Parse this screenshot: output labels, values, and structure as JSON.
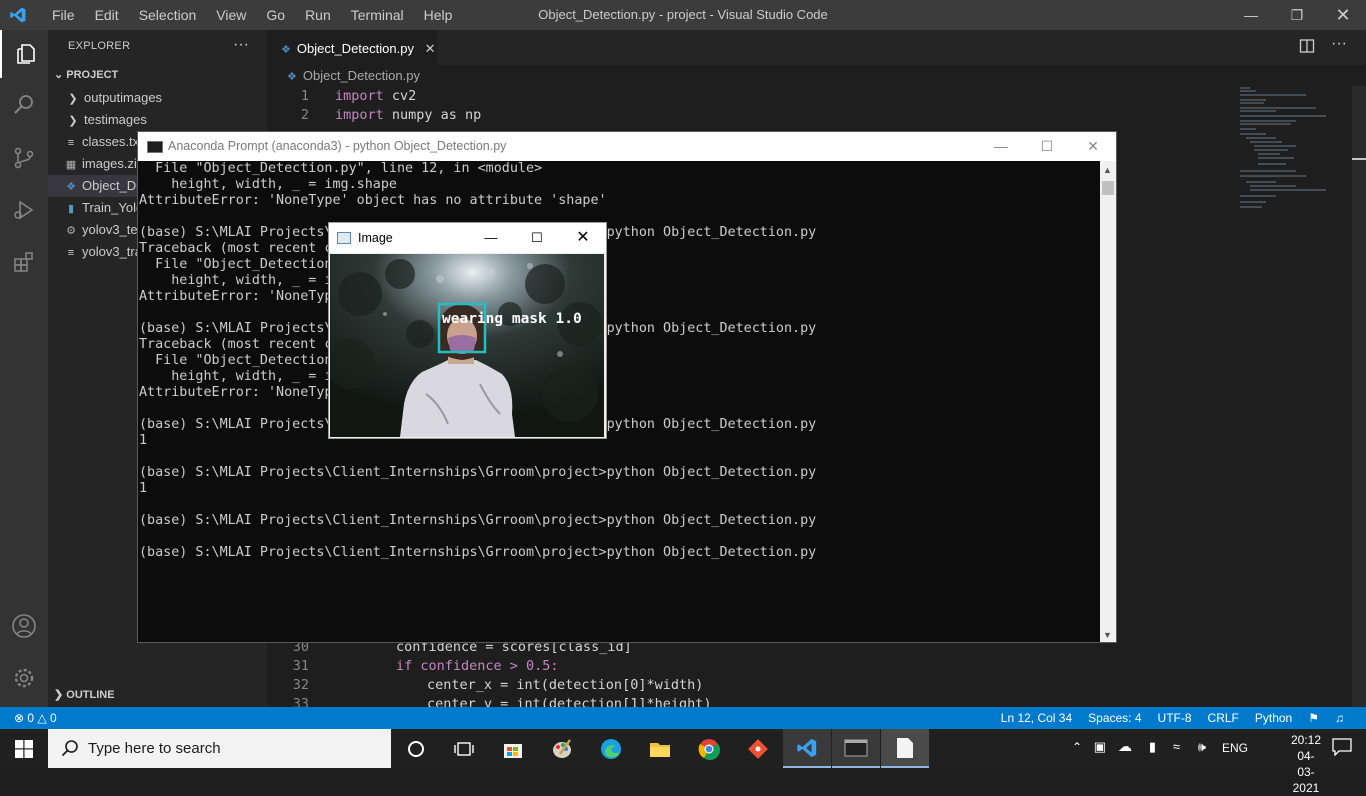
{
  "titlebar": {
    "menu": [
      "File",
      "Edit",
      "Selection",
      "View",
      "Go",
      "Run",
      "Terminal",
      "Help"
    ],
    "window_title": "Object_Detection.py - project - Visual Studio Code"
  },
  "sidebar": {
    "header": "EXPLORER",
    "project": "PROJECT",
    "items": [
      {
        "label": "outputimages",
        "kind": "folder"
      },
      {
        "label": "testimages",
        "kind": "folder"
      },
      {
        "label": "classes.txt",
        "kind": "file"
      },
      {
        "label": "images.zip",
        "kind": "file"
      },
      {
        "label": "Object_De",
        "kind": "python"
      },
      {
        "label": "Train_Yolo",
        "kind": "file"
      },
      {
        "label": "yolov3_te",
        "kind": "gear"
      },
      {
        "label": "yolov3_tra",
        "kind": "file"
      }
    ],
    "outline": "OUTLINE"
  },
  "editor": {
    "tab": "Object_Detection.py",
    "breadcrumb": "Object_Detection.py",
    "lines_top": [
      {
        "n": "1",
        "kw": "import",
        "rest": " cv2"
      },
      {
        "n": "2",
        "kw": "import",
        "rest": " numpy as np"
      }
    ],
    "lines_bottom": [
      {
        "n": "30",
        "text": "confidence = scores[class_id]"
      },
      {
        "n": "31",
        "text": "if confidence > 0.5:"
      },
      {
        "n": "32",
        "text": "center_x = int(detection[0]*width)"
      },
      {
        "n": "33",
        "text": "center_y = int(detection[1]*height)"
      }
    ]
  },
  "statusbar": {
    "problems": "0",
    "warnings": "0",
    "position": "Ln 12, Col 34",
    "spaces": "Spaces: 4",
    "encoding": "UTF-8",
    "eol": "CRLF",
    "language": "Python"
  },
  "conda": {
    "title": "Anaconda Prompt (anaconda3) - python  Object_Detection.py",
    "lines": [
      "  File \"Object_Detection.py\", line 12, in <module>",
      "    height, width, _ = img.shape",
      "AttributeError: 'NoneType' object has no attribute 'shape'",
      "",
      "(base) S:\\MLAI Projects\\Client_Internships\\Grroom\\project>python Object_Detection.py",
      "Traceback (most recent call last):",
      "  File \"Object_Detection.py\", line 12, in <module>",
      "    height, width, _ = img.shape",
      "AttributeError: 'NoneType' object has no attribute 'shape'",
      "",
      "(base) S:\\MLAI Projects\\Client_Internships\\Grroom\\project>python Object_Detection.py",
      "Traceback (most recent call last):",
      "  File \"Object_Detection.py\", line 12, in <module>",
      "    height, width, _ = img.shape",
      "AttributeError: 'NoneType' object has no attribute 'shape'",
      "",
      "(base) S:\\MLAI Projects\\Client_Internships\\Grroom\\project>python Object_Detection.py",
      "1",
      "",
      "(base) S:\\MLAI Projects\\Client_Internships\\Grroom\\project>python Object_Detection.py",
      "1",
      "",
      "(base) S:\\MLAI Projects\\Client_Internships\\Grroom\\project>python Object_Detection.py",
      "",
      "(base) S:\\MLAI Projects\\Client_Internships\\Grroom\\project>python Object_Detection.py"
    ]
  },
  "image_window": {
    "title": "Image",
    "detection_label": "wearing mask 1.0",
    "box_color": "#20c0c0"
  },
  "taskbar": {
    "search_placeholder": "Type here to search",
    "language": "ENG",
    "time": "20:12",
    "date": "04-03-2021"
  },
  "colors": {
    "accent": "#007acc",
    "titlebar": "#3c3c3c",
    "sidebar": "#252526",
    "editor": "#1e1e1e"
  }
}
